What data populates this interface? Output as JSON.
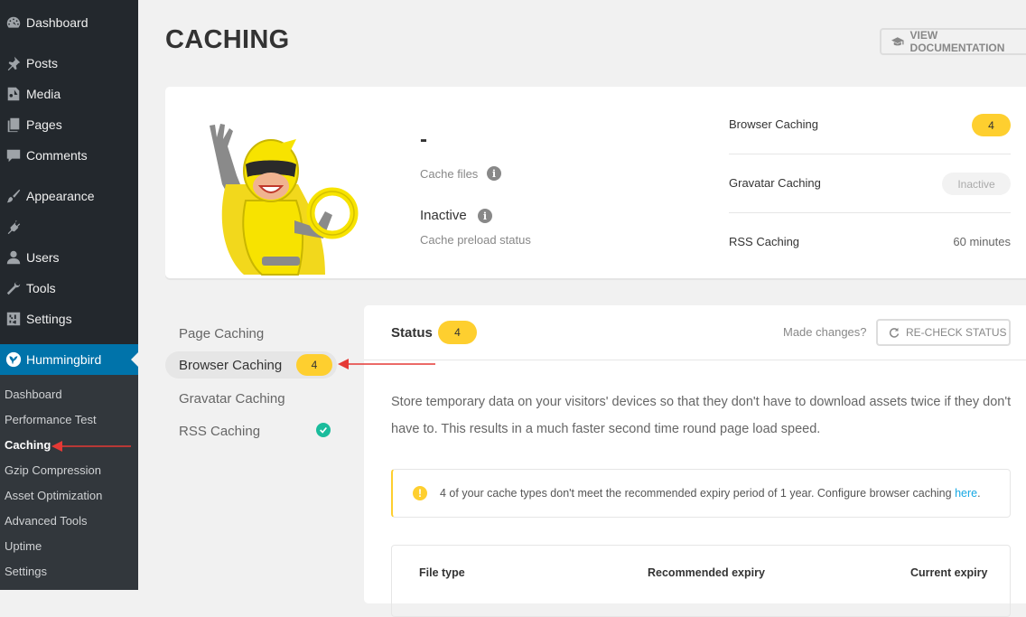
{
  "sidebar": {
    "items": [
      {
        "label": "Dashboard",
        "icon": "dashboard-icon"
      },
      {
        "label": "Posts",
        "icon": "pushpin-icon"
      },
      {
        "label": "Media",
        "icon": "media-icon"
      },
      {
        "label": "Pages",
        "icon": "pages-icon"
      },
      {
        "label": "Comments",
        "icon": "comment-icon"
      },
      {
        "label": "Appearance",
        "icon": "paintbrush-icon"
      },
      {
        "label": "",
        "icon": "plugin-icon"
      },
      {
        "label": "Users",
        "icon": "users-icon"
      },
      {
        "label": "Tools",
        "icon": "wrench-icon"
      },
      {
        "label": "Settings",
        "icon": "settings-icon"
      },
      {
        "label": "Hummingbird",
        "icon": "hummingbird-icon"
      }
    ],
    "submenu": [
      "Dashboard",
      "Performance Test",
      "Caching",
      "Gzip Compression",
      "Asset Optimization",
      "Advanced Tools",
      "Uptime",
      "Settings"
    ],
    "submenu_current": "Caching"
  },
  "header": {
    "title": "CACHING",
    "doc_button": "VIEW DOCUMENTATION"
  },
  "summary": {
    "cache_files_value": "-",
    "cache_files_label": "Cache files",
    "preload_value": "Inactive",
    "preload_label": "Cache preload status",
    "rows": [
      {
        "name": "Browser Caching",
        "value": "4"
      },
      {
        "name": "Gravatar Caching",
        "value": "Inactive"
      },
      {
        "name": "RSS Caching",
        "value": "60 minutes"
      }
    ]
  },
  "nav": {
    "items": [
      {
        "label": "Page Caching"
      },
      {
        "label": "Browser Caching",
        "badge": "4"
      },
      {
        "label": "Gravatar Caching"
      },
      {
        "label": "RSS Caching"
      }
    ]
  },
  "panel": {
    "status_label": "Status",
    "status_badge": "4",
    "made_changes": "Made changes?",
    "recheck_button": "RE-CHECK STATUS",
    "description": "Store temporary data on your visitors' devices so that they don't have to download assets twice if they don't have to. This results in a much faster second time round page load speed.",
    "notice_text": "4 of your cache types don't meet the recommended expiry period of 1 year. Configure browser caching ",
    "notice_link": "here",
    "notice_end": ".",
    "table_headers": [
      "File type",
      "Recommended expiry",
      "Current expiry"
    ]
  },
  "colors": {
    "sidebar_bg": "#23282d",
    "accent_blue": "#0073aa",
    "badge_yellow": "#fecf2f",
    "success_green": "#1abc9c",
    "annotation_red": "#e53935"
  }
}
